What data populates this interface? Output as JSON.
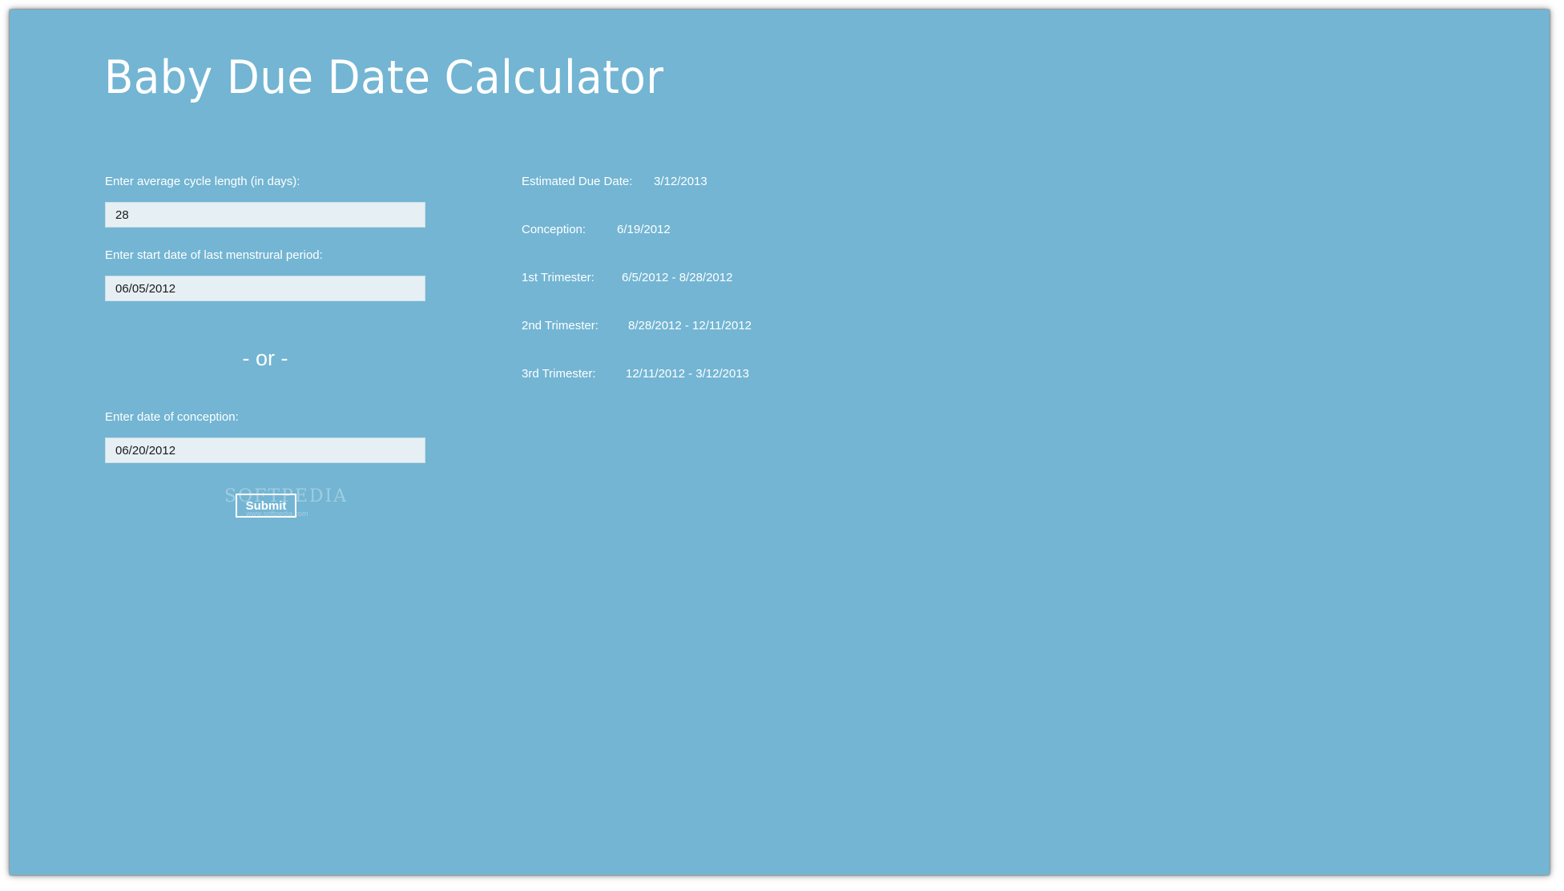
{
  "app": {
    "title": "Baby Due Date Calculator"
  },
  "form": {
    "cycle_label": "Enter average cycle length (in days):",
    "cycle_value": "28",
    "lmp_label": "Enter start date of last menstrural period:",
    "lmp_value": "06/05/2012",
    "or_text": "- or -",
    "conception_label": "Enter date of conception:",
    "conception_value": "06/20/2012",
    "submit_label": "Submit"
  },
  "watermark": {
    "text": "SOFTPEDIA",
    "sub": "www.softpedia.com"
  },
  "results": [
    {
      "label": "Estimated Due Date:",
      "value": "3/12/2013"
    },
    {
      "label": "Conception:",
      "value": "6/19/2012"
    },
    {
      "label": "1st Trimester:",
      "value": "6/5/2012 - 8/28/2012"
    },
    {
      "label": "2nd Trimester:",
      "value": "8/28/2012 - 12/11/2012"
    },
    {
      "label": "3rd Trimester:",
      "value": "12/11/2012 - 3/12/2013"
    }
  ],
  "colors": {
    "background": "#73b5d3",
    "input_background": "#e6f0f4",
    "text": "#ffffff"
  }
}
